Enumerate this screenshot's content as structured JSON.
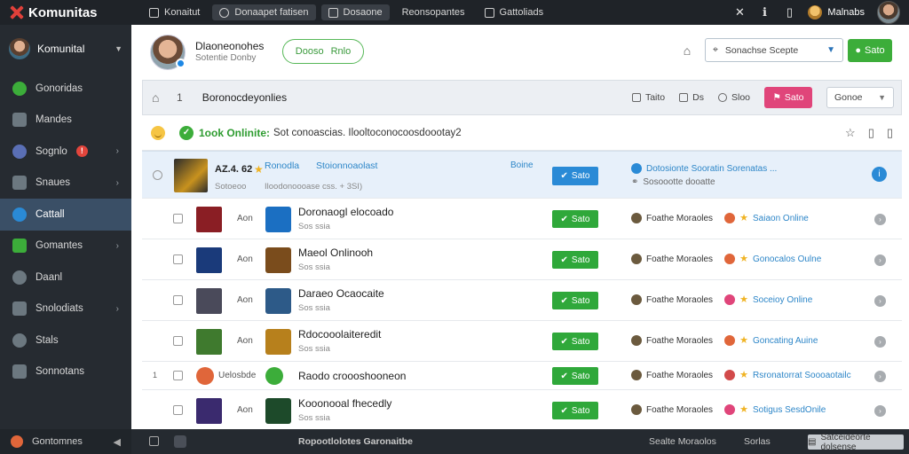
{
  "app": {
    "brand": "Komunitas",
    "tabs": [
      {
        "label": "Konaitut",
        "icon": "square-icon"
      },
      {
        "label": "Donaapet fatisen",
        "icon": "clock-icon"
      },
      {
        "label": "Dosaone",
        "icon": "grid-icon"
      },
      {
        "label": "Reonsopantes",
        "icon": ""
      },
      {
        "label": "Gattoliads",
        "icon": "square-icon"
      }
    ],
    "user_name": "Malnabs"
  },
  "sidebar": {
    "user": "Komunital",
    "items": [
      {
        "label": "Gonoridas",
        "icon": "chat-icon",
        "color": "#3cad3a",
        "arrow": false,
        "badge": ""
      },
      {
        "label": "Mandes",
        "icon": "list-icon",
        "color": "#6c7880",
        "arrow": false,
        "badge": ""
      },
      {
        "label": "Sognlo",
        "icon": "image-icon",
        "color": "#5a6fb5",
        "arrow": true,
        "badge": "!"
      },
      {
        "label": "Snaues",
        "icon": "document-icon",
        "color": "#6c7880",
        "arrow": true,
        "badge": ""
      },
      {
        "label": "Cattall",
        "icon": "monitor-icon",
        "color": "#2a8ad6",
        "arrow": false,
        "badge": "",
        "active": true
      },
      {
        "label": "Gomantes",
        "icon": "people-icon",
        "color": "#3cad3a",
        "arrow": true,
        "badge": ""
      },
      {
        "label": "Daanl",
        "icon": "user-icon",
        "color": "#6c7880",
        "arrow": false,
        "badge": ""
      },
      {
        "label": "Snolodiats",
        "icon": "settings-icon",
        "color": "#6c7880",
        "arrow": true,
        "badge": ""
      },
      {
        "label": "Stals",
        "icon": "chart-icon",
        "color": "#6c7880",
        "arrow": false,
        "badge": ""
      },
      {
        "label": "Sonnotans",
        "icon": "globe-icon",
        "color": "#6c7880",
        "arrow": false,
        "badge": ""
      }
    ],
    "footer": "Gontomnes"
  },
  "profile": {
    "name": "Dlaoneonohes",
    "subtitle": "Sotentie Donby",
    "pill_left": "Dooso",
    "pill_right": "Rnlo",
    "select": "Sonachse Scepte",
    "green_button": "Sato"
  },
  "toolbar": {
    "number": "1",
    "title": "Boronocdeyonlies",
    "actions": [
      "Taito",
      "Ds",
      "Sloo"
    ],
    "pink_button": "Sato",
    "select": "Gonoe"
  },
  "notice": {
    "strong": "1ook Onlinite:",
    "text": "Sot conoascias. Ilooltoconocoosdoootay2"
  },
  "featured": {
    "thumb_text": "AZ.4. 62",
    "title": "Ronodla",
    "subtitle": "Sotoeoo",
    "title2": "Stoionnoaolast",
    "desc": "Iloodonoooase css. + 3SI)",
    "label": "Boine",
    "button": "Sato",
    "status_title": "Dotosionte Sooratin Sorenatas ...",
    "status_sub": "Sosoootte dooatte"
  },
  "rows": [
    {
      "small": "Aon",
      "title": "Doronaogl elocoado",
      "sub": "Sos ssia",
      "button": "Sato",
      "status": "Foathe Moraoles",
      "online": "Saiaon Online",
      "colors": [
        "#8a1e24",
        "#1f8fd6",
        "#e0663a"
      ],
      "thumb2": "#1b6fc2"
    },
    {
      "small": "Aon",
      "title": "Maeol Onlinooh",
      "sub": "Sos ssia",
      "button": "Sato",
      "status": "Foathe Moraoles",
      "online": "Gonocalos Oulne",
      "colors": [
        "#1a3a7a",
        "#8a5a1e",
        "#e0663a"
      ],
      "thumb2": "#7a4c1c"
    },
    {
      "small": "Aon",
      "title": "Daraeo Ocaocaite",
      "sub": "Sos ssia",
      "button": "Sato",
      "status": "Foathe Moraoles",
      "online": "Soceioy Online",
      "colors": [
        "#4a4a5a",
        "#3a5b8a",
        "#e0457a"
      ],
      "thumb2": "#2d5a88"
    },
    {
      "small": "Aon",
      "title": "Rdocooolaiteredit",
      "sub": "Sos ssia",
      "button": "Sato",
      "status": "Foathe Moraoles",
      "online": "Goncating Auine",
      "colors": [
        "#3f7a2e",
        "#a9741e",
        "#e0663a"
      ],
      "thumb2": "#b7801c"
    },
    {
      "small": "Uelosbde",
      "title": "Raodo croooshooneon",
      "sub": "",
      "button": "Sato",
      "status": "Foathe Moraoles",
      "online": "Rsronatorrat Soooaotailc",
      "colors": [
        "#e0663a",
        "#3cad3a",
        "#d24a4a"
      ],
      "thumb2": "#3cad3a",
      "num": "1"
    },
    {
      "small": "Aon",
      "title": "Kooonooal fhecedly",
      "sub": "Sos ssia",
      "button": "Sato",
      "status": "Foathe Moraoles",
      "online": "Sotigus SesdOnile",
      "colors": [
        "#3a2a6e",
        "#2d6a3a",
        "#e0457a"
      ],
      "thumb2": "#1d4a2a"
    }
  ],
  "bottombar": {
    "left": "Ropootlolotes Garonaitbe",
    "right_a": "Sealte Moraolos",
    "right_b": "Sorlas",
    "badge": "Satceideorte dolsense"
  }
}
